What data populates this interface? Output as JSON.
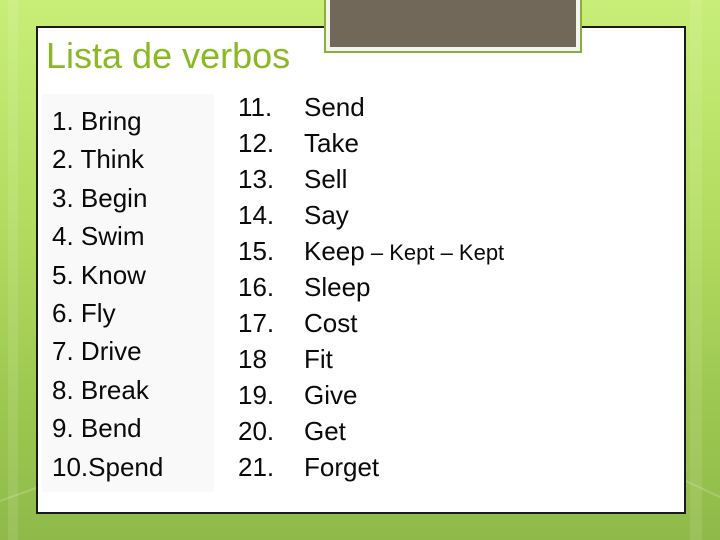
{
  "slide": {
    "title": "Lista de verbos",
    "left_column": [
      {
        "number": "1.",
        "verb": "Bring"
      },
      {
        "number": "2.",
        "verb": "Think"
      },
      {
        "number": "3.",
        "verb": "Begin"
      },
      {
        "number": "4.",
        "verb": "Swim"
      },
      {
        "number": "5.",
        "verb": "Know"
      },
      {
        "number": "6.",
        "verb": "Fly"
      },
      {
        "number": "7.",
        "verb": "Drive"
      },
      {
        "number": "8.",
        "verb": "Break"
      },
      {
        "number": "9.",
        "verb": "Bend"
      },
      {
        "number": "10.",
        "verb": "Spend"
      }
    ],
    "right_column": [
      {
        "number": "11.",
        "verb": "Send",
        "extra": ""
      },
      {
        "number": "12.",
        "verb": "Take",
        "extra": ""
      },
      {
        "number": "13.",
        "verb": "Sell",
        "extra": ""
      },
      {
        "number": "14.",
        "verb": "Say",
        "extra": ""
      },
      {
        "number": "15.",
        "verb": "Keep",
        "extra": " – Kept – Kept"
      },
      {
        "number": "16.",
        "verb": "Sleep",
        "extra": ""
      },
      {
        "number": "17.",
        "verb": "Cost",
        "extra": ""
      },
      {
        "number": "18",
        "verb": "Fit",
        "extra": ""
      },
      {
        "number": "19.",
        "verb": "Give",
        "extra": ""
      },
      {
        "number": "20.",
        "verb": "Get",
        "extra": ""
      },
      {
        "number": "21.",
        "verb": "Forget",
        "extra": ""
      }
    ]
  },
  "colors": {
    "title": "#8cb825",
    "background_green": "#b4dc60",
    "title_bar": "#72685a",
    "text": "#0a0a0a"
  }
}
